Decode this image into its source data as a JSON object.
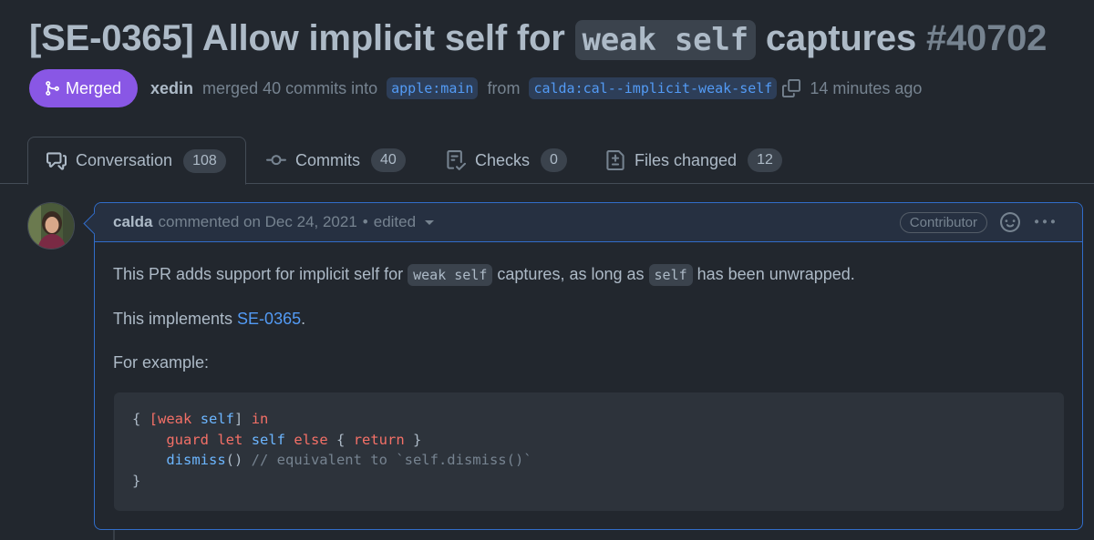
{
  "pr": {
    "title_prefix": "[SE-0365] Allow implicit self for ",
    "title_code": "weak self",
    "title_suffix": " captures",
    "number": "#40702",
    "state": "Merged",
    "author": "xedin",
    "merged_text": "merged 40 commits into",
    "base_branch": "apple:main",
    "from_text": "from",
    "head_branch": "calda:cal--implicit-weak-self",
    "time": "14 minutes ago"
  },
  "tabs": [
    {
      "label": "Conversation",
      "count": "108",
      "icon": "comment-discussion-icon"
    },
    {
      "label": "Commits",
      "count": "40",
      "icon": "git-commit-icon"
    },
    {
      "label": "Checks",
      "count": "0",
      "icon": "checklist-icon"
    },
    {
      "label": "Files changed",
      "count": "12",
      "icon": "file-diff-icon"
    }
  ],
  "comment": {
    "author": "calda",
    "meta": "commented on Dec 24, 2021",
    "separator": "•",
    "edited": "edited",
    "role": "Contributor",
    "body": {
      "p1_a": "This PR adds support for implicit self for ",
      "p1_code1": "weak self",
      "p1_b": " captures, as long as ",
      "p1_code2": "self",
      "p1_c": " has been unwrapped.",
      "p2_a": "This implements ",
      "p2_link": "SE-0365",
      "p2_b": ".",
      "p3": "For example:"
    },
    "code": {
      "l1_a": "{ ",
      "l1_b": "[",
      "l1_weak": "weak",
      "l1_sp": " ",
      "l1_self": "self",
      "l1_c": "] ",
      "l1_in": "in",
      "l2_indent": "    ",
      "l2_guard": "guard",
      "l2_sp1": " ",
      "l2_let": "let",
      "l2_sp2": " ",
      "l2_self": "self",
      "l2_sp3": " ",
      "l2_else": "else",
      "l2_b": " { ",
      "l2_return": "return",
      "l2_c": " }",
      "l3_indent": "    ",
      "l3_fn": "dismiss",
      "l3_b": "() ",
      "l3_comment": "// equivalent to `self.dismiss()`",
      "l4": "}"
    }
  },
  "colors": {
    "background": "#22272e",
    "merged": "#8957e5",
    "link": "#539bf5",
    "focus_border": "#316dca"
  }
}
